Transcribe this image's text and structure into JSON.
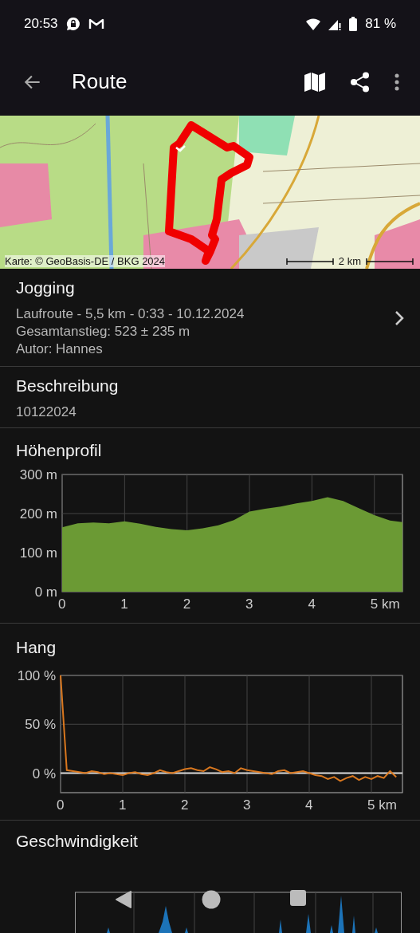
{
  "status_bar": {
    "time": "20:53",
    "battery": "81 %"
  },
  "app_bar": {
    "title": "Route"
  },
  "map": {
    "attribution": "Karte: © GeoBasis-DE / BKG 2024",
    "scale": "2 km"
  },
  "summary": {
    "title": "Jogging",
    "lines": [
      "Laufroute - 5,5 km - 0:33 - 10.12.2024",
      "Gesamtanstieg: 523 ± 235 m",
      "Autor: Hannes"
    ]
  },
  "description": {
    "title": "Beschreibung",
    "text": "10122024"
  },
  "elevation": {
    "title": "Höhenprofil",
    "chart_data": {
      "type": "area",
      "x": [
        0,
        0.25,
        0.5,
        0.75,
        1,
        1.25,
        1.5,
        1.75,
        2,
        2.25,
        2.5,
        2.75,
        3,
        3.25,
        3.5,
        3.75,
        4,
        4.25,
        4.5,
        4.75,
        5,
        5.25,
        5.45
      ],
      "series": [
        {
          "color": "#6b9a34",
          "values": [
            165,
            175,
            177,
            175,
            180,
            174,
            166,
            160,
            157,
            162,
            170,
            183,
            205,
            212,
            218,
            226,
            232,
            242,
            232,
            214,
            196,
            182,
            178
          ]
        }
      ],
      "xlim": [
        0,
        5.45
      ],
      "ylim": [
        0,
        300
      ],
      "grid": true,
      "xticks": [
        {
          "value": 0,
          "label": "0"
        },
        {
          "value": 1,
          "label": "1"
        },
        {
          "value": 2,
          "label": "2"
        },
        {
          "value": 3,
          "label": "3"
        },
        {
          "value": 4,
          "label": "4"
        },
        {
          "value": 5,
          "label": "5 km"
        }
      ],
      "yticks": [
        {
          "value": 0,
          "label": "0 m"
        },
        {
          "value": 100,
          "label": "100 m"
        },
        {
          "value": 200,
          "label": "200 m"
        },
        {
          "value": 300,
          "label": "300 m"
        }
      ]
    }
  },
  "slope": {
    "title": "Hang",
    "chart_data": {
      "type": "line",
      "x": [
        0,
        0.1,
        0.2,
        0.3,
        0.4,
        0.5,
        0.6,
        0.7,
        0.8,
        0.9,
        1,
        1.1,
        1.2,
        1.3,
        1.4,
        1.5,
        1.6,
        1.7,
        1.8,
        1.9,
        2,
        2.1,
        2.2,
        2.3,
        2.4,
        2.5,
        2.6,
        2.7,
        2.8,
        2.9,
        3,
        3.1,
        3.2,
        3.3,
        3.4,
        3.5,
        3.6,
        3.7,
        3.8,
        3.9,
        4,
        4.1,
        4.2,
        4.3,
        4.4,
        4.5,
        4.6,
        4.7,
        4.8,
        4.9,
        5,
        5.1,
        5.2,
        5.3,
        5.4
      ],
      "series": [
        {
          "color": "#d9771e",
          "values": [
            100,
            3,
            2,
            1,
            0,
            2,
            1,
            -1,
            0,
            -1,
            -2,
            0,
            1,
            -1,
            -2,
            0,
            3,
            1,
            0,
            2,
            4,
            5,
            3,
            2,
            6,
            4,
            1,
            2,
            0,
            5,
            3,
            2,
            1,
            0,
            -1,
            2,
            3,
            0,
            1,
            2,
            0,
            -2,
            -3,
            -6,
            -4,
            -8,
            -5,
            -3,
            -7,
            -4,
            -6,
            -3,
            -5,
            2,
            -4
          ]
        }
      ],
      "xlim": [
        0,
        5.5
      ],
      "ylim": [
        -20,
        100
      ],
      "grid": true,
      "xticks": [
        {
          "value": 0,
          "label": "0"
        },
        {
          "value": 1,
          "label": "1"
        },
        {
          "value": 2,
          "label": "2"
        },
        {
          "value": 3,
          "label": "3"
        },
        {
          "value": 4,
          "label": "4"
        },
        {
          "value": 5,
          "label": "5 km"
        }
      ],
      "yticks": [
        {
          "value": 0,
          "label": "0 %"
        },
        {
          "value": 50,
          "label": "50 %"
        },
        {
          "value": 100,
          "label": "100 %"
        }
      ]
    }
  },
  "speed": {
    "title": "Geschwindigkeit"
  }
}
